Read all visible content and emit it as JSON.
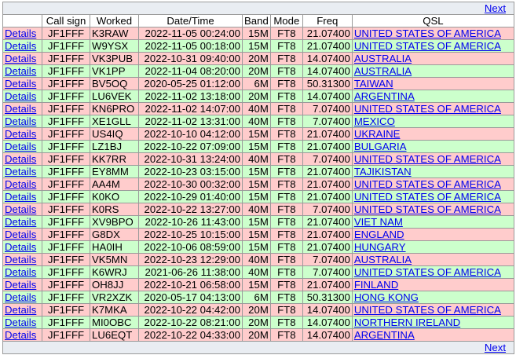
{
  "nav": {
    "next_label": "Next"
  },
  "headers": {
    "details": "",
    "callsign": "Call sign",
    "worked": "Worked",
    "datetime": "Date/Time",
    "band": "Band",
    "mode": "Mode",
    "freq": "Freq",
    "qsl": "QSL"
  },
  "rows": [
    {
      "details": "Details",
      "callsign": "JF1FFF",
      "worked": "K3RAW",
      "datetime": "2022-11-05 00:24:00",
      "band": "15M",
      "mode": "FT8",
      "freq": "21.07400",
      "qsl": "UNITED STATES OF AMERICA",
      "status": "pink"
    },
    {
      "details": "Details",
      "callsign": "JF1FFF",
      "worked": "W9YSX",
      "datetime": "2022-11-05 00:18:00",
      "band": "15M",
      "mode": "FT8",
      "freq": "21.07400",
      "qsl": "UNITED STATES OF AMERICA",
      "status": "green"
    },
    {
      "details": "Details",
      "callsign": "JF1FFF",
      "worked": "VK3PUB",
      "datetime": "2022-10-31 09:40:00",
      "band": "20M",
      "mode": "FT8",
      "freq": "14.07400",
      "qsl": "AUSTRALIA",
      "status": "pink"
    },
    {
      "details": "Details",
      "callsign": "JF1FFF",
      "worked": "VK1PP",
      "datetime": "2022-11-04 08:20:00",
      "band": "20M",
      "mode": "FT8",
      "freq": "14.07400",
      "qsl": "AUSTRALIA",
      "status": "green"
    },
    {
      "details": "Details",
      "callsign": "JF1FFF",
      "worked": "BV5OQ",
      "datetime": "2020-05-25 01:12:00",
      "band": "6M",
      "mode": "FT8",
      "freq": "50.31300",
      "qsl": "TAIWAN",
      "status": "pink"
    },
    {
      "details": "Details",
      "callsign": "JF1FFF",
      "worked": "LU6VEK",
      "datetime": "2022-11-02 13:18:00",
      "band": "20M",
      "mode": "FT8",
      "freq": "14.07400",
      "qsl": "ARGENTINA",
      "status": "green"
    },
    {
      "details": "Details",
      "callsign": "JF1FFF",
      "worked": "KN6PRO",
      "datetime": "2022-11-02 14:07:00",
      "band": "40M",
      "mode": "FT8",
      "freq": "7.07400",
      "qsl": "UNITED STATES OF AMERICA",
      "status": "pink"
    },
    {
      "details": "Details",
      "callsign": "JF1FFF",
      "worked": "XE1GLL",
      "datetime": "2022-11-02 13:31:00",
      "band": "40M",
      "mode": "FT8",
      "freq": "7.07400",
      "qsl": "MEXICO",
      "status": "green"
    },
    {
      "details": "Details",
      "callsign": "JF1FFF",
      "worked": "US4IQ",
      "datetime": "2022-10-10 04:12:00",
      "band": "15M",
      "mode": "FT8",
      "freq": "21.07400",
      "qsl": "UKRAINE",
      "status": "pink"
    },
    {
      "details": "Details",
      "callsign": "JF1FFF",
      "worked": "LZ1BJ",
      "datetime": "2022-10-22 07:09:00",
      "band": "15M",
      "mode": "FT8",
      "freq": "21.07400",
      "qsl": "BULGARIA",
      "status": "green"
    },
    {
      "details": "Details",
      "callsign": "JF1FFF",
      "worked": "KK7RR",
      "datetime": "2022-10-31 13:24:00",
      "band": "40M",
      "mode": "FT8",
      "freq": "7.07400",
      "qsl": "UNITED STATES OF AMERICA",
      "status": "pink"
    },
    {
      "details": "Details",
      "callsign": "JF1FFF",
      "worked": "EY8MM",
      "datetime": "2022-10-23 03:15:00",
      "band": "15M",
      "mode": "FT8",
      "freq": "21.07400",
      "qsl": "TAJIKISTAN",
      "status": "green"
    },
    {
      "details": "Details",
      "callsign": "JF1FFF",
      "worked": "AA4M",
      "datetime": "2022-10-30 00:32:00",
      "band": "15M",
      "mode": "FT8",
      "freq": "21.07400",
      "qsl": "UNITED STATES OF AMERICA",
      "status": "pink"
    },
    {
      "details": "Details",
      "callsign": "JF1FFF",
      "worked": "K0KO",
      "datetime": "2022-10-29 01:40:00",
      "band": "15M",
      "mode": "FT8",
      "freq": "21.07400",
      "qsl": "UNITED STATES OF AMERICA",
      "status": "green"
    },
    {
      "details": "Details",
      "callsign": "JF1FFF",
      "worked": "K0RS",
      "datetime": "2022-10-22 13:27:00",
      "band": "40M",
      "mode": "FT8",
      "freq": "7.07400",
      "qsl": "UNITED STATES OF AMERICA",
      "status": "pink"
    },
    {
      "details": "Details",
      "callsign": "JF1FFF",
      "worked": "XV9BPO",
      "datetime": "2022-10-26 11:43:00",
      "band": "15M",
      "mode": "FT8",
      "freq": "21.07400",
      "qsl": "VIET NAM",
      "status": "green"
    },
    {
      "details": "Details",
      "callsign": "JF1FFF",
      "worked": "G8DX",
      "datetime": "2022-10-25 10:15:00",
      "band": "15M",
      "mode": "FT8",
      "freq": "21.07400",
      "qsl": "ENGLAND",
      "status": "pink"
    },
    {
      "details": "Details",
      "callsign": "JF1FFF",
      "worked": "HA0IH",
      "datetime": "2022-10-06 08:59:00",
      "band": "15M",
      "mode": "FT8",
      "freq": "21.07400",
      "qsl": "HUNGARY",
      "status": "green"
    },
    {
      "details": "Details",
      "callsign": "JF1FFF",
      "worked": "VK5MN",
      "datetime": "2022-10-23 12:29:00",
      "band": "40M",
      "mode": "FT8",
      "freq": "7.07400",
      "qsl": "AUSTRALIA",
      "status": "pink"
    },
    {
      "details": "Details",
      "callsign": "JF1FFF",
      "worked": "K6WRJ",
      "datetime": "2021-06-26 11:38:00",
      "band": "40M",
      "mode": "FT8",
      "freq": "7.07400",
      "qsl": "UNITED STATES OF AMERICA",
      "status": "green"
    },
    {
      "details": "Details",
      "callsign": "JF1FFF",
      "worked": "OH8JJ",
      "datetime": "2022-10-21 06:58:00",
      "band": "15M",
      "mode": "FT8",
      "freq": "21.07400",
      "qsl": "FINLAND",
      "status": "pink"
    },
    {
      "details": "Details",
      "callsign": "JF1FFF",
      "worked": "VR2XZK",
      "datetime": "2020-05-17 04:13:00",
      "band": "6M",
      "mode": "FT8",
      "freq": "50.31300",
      "qsl": "HONG KONG",
      "status": "green"
    },
    {
      "details": "Details",
      "callsign": "JF1FFF",
      "worked": "K7MKA",
      "datetime": "2022-10-22 04:42:00",
      "band": "20M",
      "mode": "FT8",
      "freq": "14.07400",
      "qsl": "UNITED STATES OF AMERICA",
      "status": "pink"
    },
    {
      "details": "Details",
      "callsign": "JF1FFF",
      "worked": "MI0OBC",
      "datetime": "2022-10-22 08:21:00",
      "band": "20M",
      "mode": "FT8",
      "freq": "14.07400",
      "qsl": "NORTHERN IRELAND",
      "status": "green"
    },
    {
      "details": "Details",
      "callsign": "JF1FFF",
      "worked": "LU6EQT",
      "datetime": "2022-10-22 04:33:00",
      "band": "20M",
      "mode": "FT8",
      "freq": "14.07400",
      "qsl": "ARGENTINA",
      "status": "pink"
    }
  ],
  "colors": {
    "pink_row": "#ffcccc",
    "green_row": "#ccffcc",
    "link": "#0000ee",
    "nav_bg": "#e9edf2"
  }
}
